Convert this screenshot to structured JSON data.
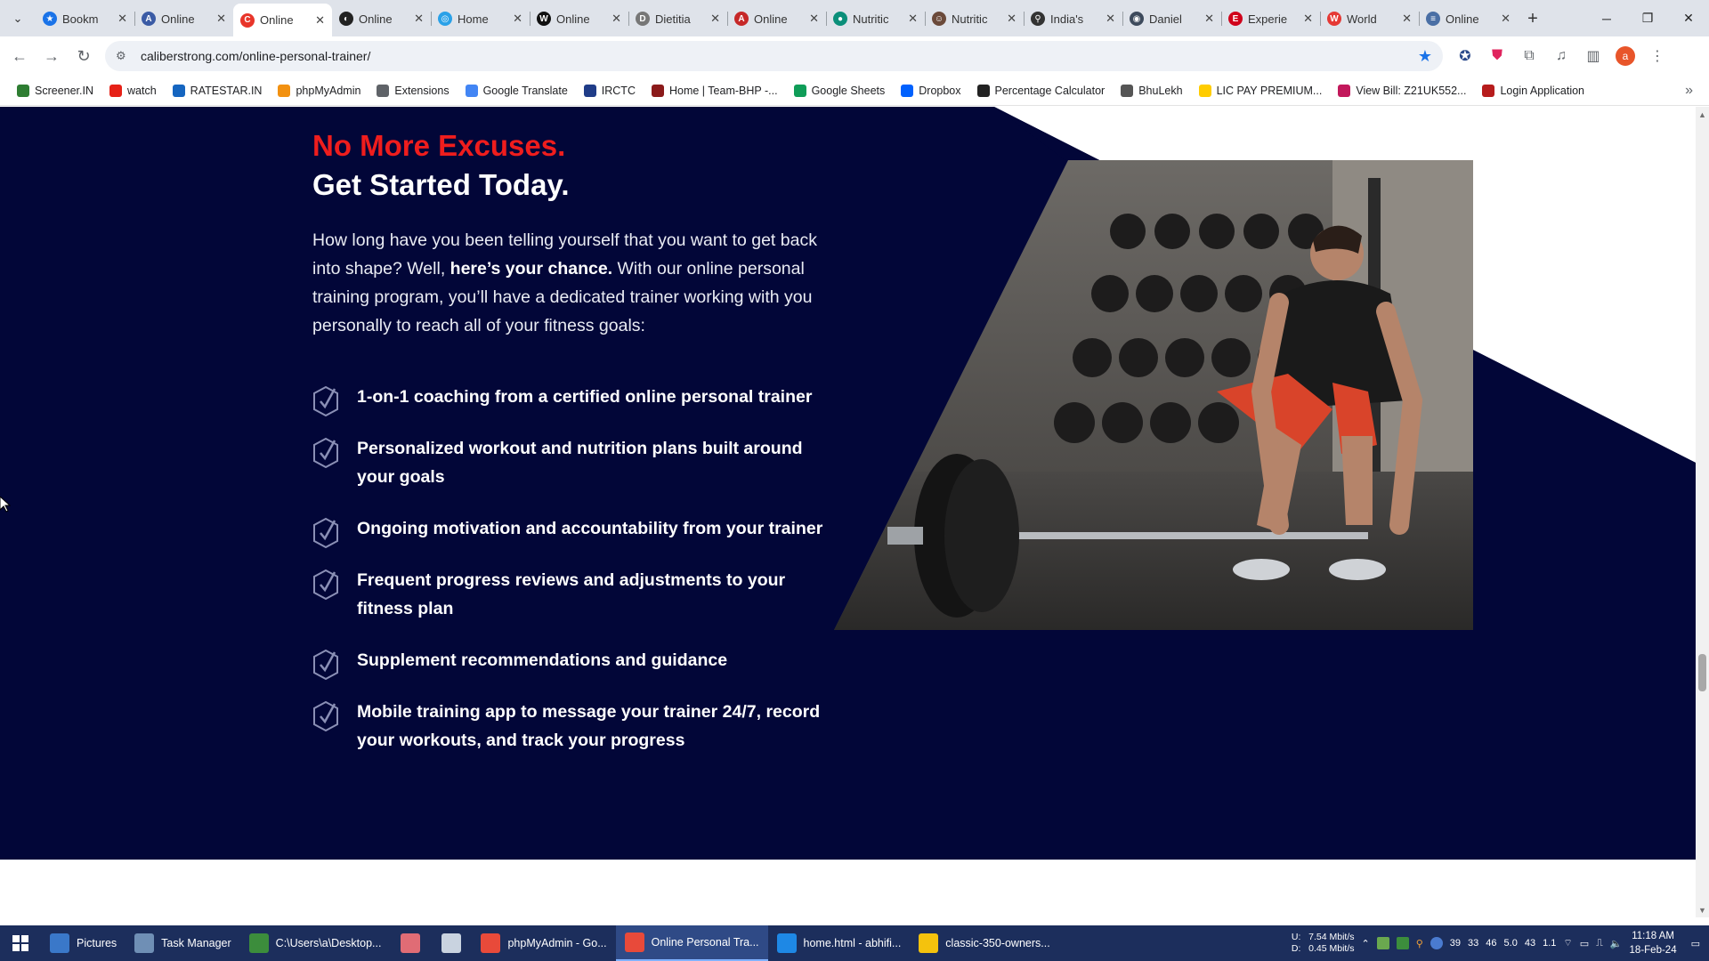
{
  "browser": {
    "tabs": [
      {
        "title": "Bookm",
        "favicon_color": "#1a73e8",
        "favicon_glyph": "★"
      },
      {
        "title": "Online",
        "favicon_color": "#3b5ba5",
        "favicon_glyph": "A"
      },
      {
        "title": "Online",
        "favicon_color": "#e8352a",
        "favicon_glyph": "C",
        "active": true
      },
      {
        "title": "Online",
        "favicon_color": "#222222",
        "favicon_glyph": "◐"
      },
      {
        "title": "Home",
        "favicon_color": "#2aa1e8",
        "favicon_glyph": "◎"
      },
      {
        "title": "Online",
        "favicon_color": "#111111",
        "favicon_glyph": "W"
      },
      {
        "title": "Dietitia",
        "favicon_color": "#777777",
        "favicon_glyph": "D"
      },
      {
        "title": "Online",
        "favicon_color": "#c62828",
        "favicon_glyph": "A"
      },
      {
        "title": "Nutritic",
        "favicon_color": "#0b8f7a",
        "favicon_glyph": "●"
      },
      {
        "title": "Nutritic",
        "favicon_color": "#6b4a3a",
        "favicon_glyph": "☺"
      },
      {
        "title": "India's",
        "favicon_color": "#333333",
        "favicon_glyph": "⚲"
      },
      {
        "title": "Daniel",
        "favicon_color": "#3d4a5c",
        "favicon_glyph": "◉"
      },
      {
        "title": "Experie",
        "favicon_color": "#d0021b",
        "favicon_glyph": "E"
      },
      {
        "title": "World",
        "favicon_color": "#e53935",
        "favicon_glyph": "W"
      },
      {
        "title": "Online",
        "favicon_color": "#4a6fa5",
        "favicon_glyph": "≡"
      }
    ],
    "url": "caliberstrong.com/online-personal-trainer/",
    "profile_initial": "a",
    "bookmarks": [
      {
        "label": "Screener.IN",
        "color": "#2e7d32"
      },
      {
        "label": "watch",
        "color": "#e62117"
      },
      {
        "label": "RATESTAR.IN",
        "color": "#1565c0"
      },
      {
        "label": "phpMyAdmin",
        "color": "#f29111"
      },
      {
        "label": "Extensions",
        "color": "#5f6368"
      },
      {
        "label": "Google Translate",
        "color": "#4285f4"
      },
      {
        "label": "IRCTC",
        "color": "#1f3c88"
      },
      {
        "label": "Home | Team-BHP -...",
        "color": "#8b1a1a"
      },
      {
        "label": "Google Sheets",
        "color": "#0f9d58"
      },
      {
        "label": "Dropbox",
        "color": "#0061fe"
      },
      {
        "label": "Percentage Calculator",
        "color": "#222222"
      },
      {
        "label": "BhuLekh",
        "color": "#555555"
      },
      {
        "label": "LIC PAY PREMIUM...",
        "color": "#ffcc00"
      },
      {
        "label": "View Bill: Z21UK552...",
        "color": "#c2185b"
      },
      {
        "label": "Login Application",
        "color": "#b71c1c"
      }
    ]
  },
  "page": {
    "headline_red": "No More Excuses.",
    "headline_white": "Get Started Today.",
    "intro_part1": "How long have you been telling yourself that you want to get back into shape? Well, ",
    "intro_bold": "here’s your chance.",
    "intro_part2": " With our online personal training program, you’ll have a dedicated trainer working with you personally to reach all of your fitness goals:",
    "benefits": [
      "1-on-1 coaching from a certified online personal trainer",
      "Personalized workout and nutrition plans built around  your goals",
      "Ongoing motivation and accountability from your trainer",
      "Frequent progress reviews and adjustments to your  fitness plan",
      "Supplement recommendations and guidance",
      "Mobile training app to message your trainer 24/7,  record your workouts, and track your progress"
    ],
    "colors": {
      "background": "#020638",
      "accent_red": "#ef1d1d",
      "text": "#ffffff"
    }
  },
  "taskbar": {
    "apps": [
      {
        "label": "Pictures",
        "color": "#3a78c9"
      },
      {
        "label": "Task Manager",
        "color": "#6f8fb5"
      },
      {
        "label": "C:\\Users\\a\\Desktop...",
        "color": "#3c8d3c"
      },
      {
        "label": "",
        "color": "#e06c75"
      },
      {
        "label": "",
        "color": "#c9d3e0"
      },
      {
        "label": "phpMyAdmin - Go...",
        "color": "#e84a3a"
      },
      {
        "label": "Online Personal Tra...",
        "color": "#e84a3a",
        "active": true
      },
      {
        "label": "home.html - abhifi...",
        "color": "#1e88e5"
      },
      {
        "label": "classic-350-owners...",
        "color": "#f4c20d"
      }
    ],
    "net_upload_label": "U:",
    "net_upload": "7.54 Mbit/s",
    "net_download_label": "D:",
    "net_download": "0.45 Mbit/s",
    "tray_numbers": [
      "39",
      "33",
      "46",
      "5.0",
      "43",
      "1.1"
    ],
    "time": "11:18 AM",
    "date": "18-Feb-24"
  }
}
